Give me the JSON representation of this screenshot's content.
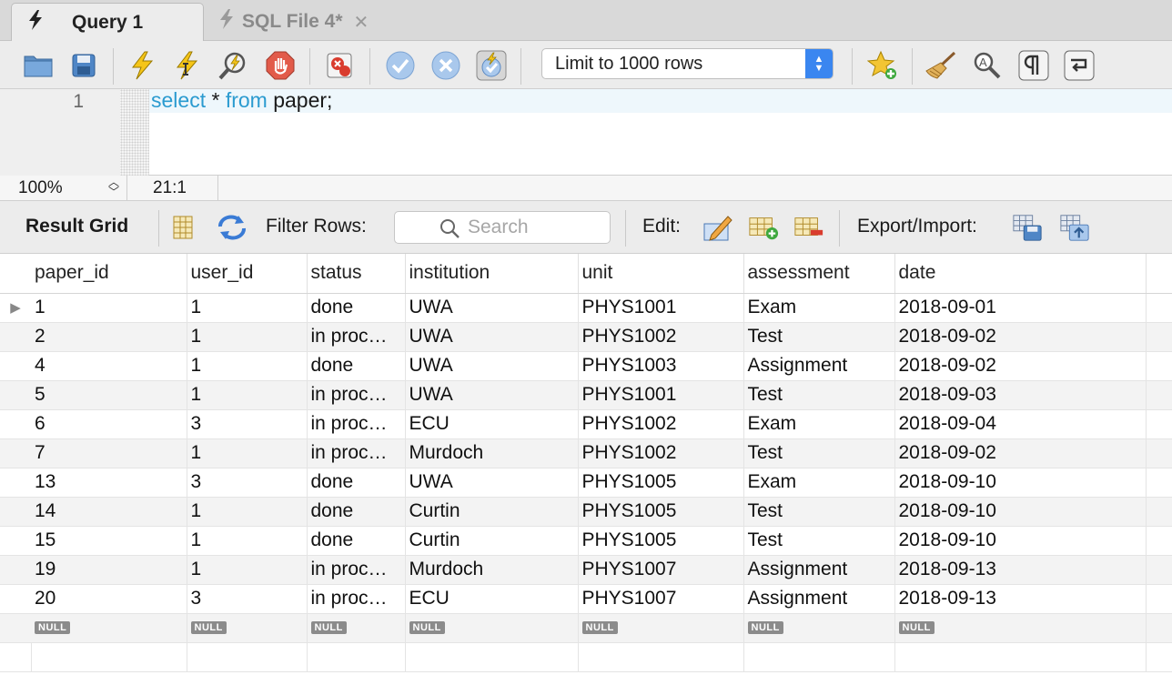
{
  "tabs": [
    {
      "label": "Query 1",
      "active": true
    },
    {
      "label": "SQL File 4*",
      "active": false
    }
  ],
  "toolbar": {
    "limit_select": "Limit to 1000 rows"
  },
  "editor": {
    "line_number": "1",
    "keyword_select": "select",
    "star": " * ",
    "keyword_from": "from",
    "table_text": " paper;"
  },
  "status": {
    "zoom": "100%",
    "cursor": "21:1"
  },
  "result_bar": {
    "result_grid": "Result Grid",
    "filter_rows": "Filter Rows:",
    "search_placeholder": "Search",
    "edit": "Edit:",
    "export_import": "Export/Import:"
  },
  "grid": {
    "columns": [
      "paper_id",
      "user_id",
      "status",
      "institution",
      "unit",
      "assessment",
      "date"
    ],
    "rows": [
      [
        "1",
        "1",
        "done",
        "UWA",
        "PHYS1001",
        "Exam",
        "2018-09-01"
      ],
      [
        "2",
        "1",
        "in proc…",
        "UWA",
        "PHYS1002",
        "Test",
        "2018-09-02"
      ],
      [
        "4",
        "1",
        "done",
        "UWA",
        "PHYS1003",
        "Assignment",
        "2018-09-02"
      ],
      [
        "5",
        "1",
        "in proc…",
        "UWA",
        "PHYS1001",
        "Test",
        "2018-09-03"
      ],
      [
        "6",
        "3",
        "in proc…",
        "ECU",
        "PHYS1002",
        "Exam",
        "2018-09-04"
      ],
      [
        "7",
        "1",
        "in proc…",
        "Murdoch",
        "PHYS1002",
        "Test",
        "2018-09-02"
      ],
      [
        "13",
        "3",
        "done",
        "UWA",
        "PHYS1005",
        "Exam",
        "2018-09-10"
      ],
      [
        "14",
        "1",
        "done",
        "Curtin",
        "PHYS1005",
        "Test",
        "2018-09-10"
      ],
      [
        "15",
        "1",
        "done",
        "Curtin",
        "PHYS1005",
        "Test",
        "2018-09-10"
      ],
      [
        "19",
        "1",
        "in proc…",
        "Murdoch",
        "PHYS1007",
        "Assignment",
        "2018-09-13"
      ],
      [
        "20",
        "3",
        "in proc…",
        "ECU",
        "PHYS1007",
        "Assignment",
        "2018-09-13"
      ]
    ],
    "null_label": "NULL"
  },
  "colors": {
    "keyword": "#2b9bd0",
    "select_accent": "#3a86f0"
  }
}
